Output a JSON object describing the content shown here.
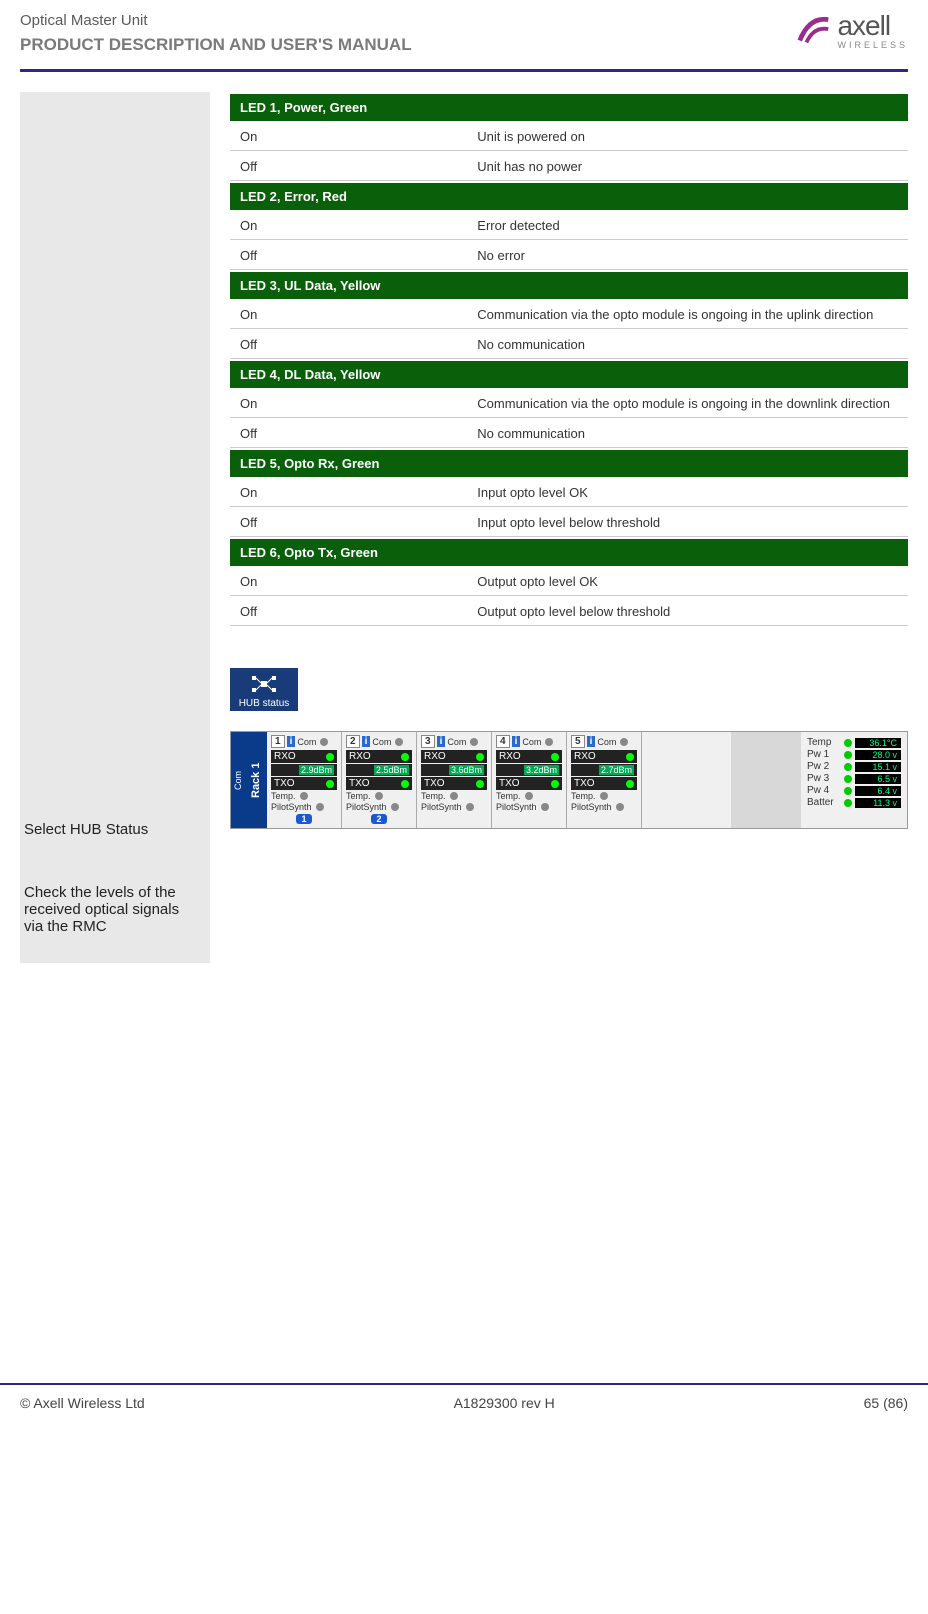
{
  "header": {
    "title": "Optical Master Unit",
    "subtitle": "PRODUCT DESCRIPTION AND USER'S MANUAL",
    "logo_main": "axell",
    "logo_sub": "WIRELESS"
  },
  "led_table": {
    "sections": [
      {
        "header": "LED 1, Power, Green",
        "rows": [
          {
            "state": "On",
            "desc": "Unit is powered on"
          },
          {
            "state": "Off",
            "desc": "Unit has no power"
          }
        ]
      },
      {
        "header": "LED 2, Error, Red",
        "rows": [
          {
            "state": "On",
            "desc": "Error detected"
          },
          {
            "state": "Off",
            "desc": "No error"
          }
        ]
      },
      {
        "header": "LED 3, UL Data, Yellow",
        "rows": [
          {
            "state": "On",
            "desc": "Communication via the opto module is ongoing in the uplink direction"
          },
          {
            "state": "Off",
            "desc": "No communication"
          }
        ]
      },
      {
        "header": "LED 4, DL Data, Yellow",
        "rows": [
          {
            "state": "On",
            "desc": "Communication via the opto module is ongoing in the downlink direction"
          },
          {
            "state": "Off",
            "desc": "No communication"
          }
        ]
      },
      {
        "header": "LED 5, Opto Rx, Green",
        "rows": [
          {
            "state": "On",
            "desc": "Input opto level OK"
          },
          {
            "state": "Off",
            "desc": "Input opto level below threshold"
          }
        ]
      },
      {
        "header": "LED 6, Opto Tx, Green",
        "rows": [
          {
            "state": "On",
            "desc": "Output opto level OK"
          },
          {
            "state": "Off",
            "desc": "Output opto level below threshold"
          }
        ]
      }
    ]
  },
  "steps": {
    "step1": "Select HUB Status",
    "step2": "Check the levels of the received optical signals via the RMC"
  },
  "hub_status_button": "HUB status",
  "rmc": {
    "rack_label": "Rack 1",
    "com_label": "Com",
    "slots": [
      {
        "num": "1",
        "rx_label": "RXO",
        "rx_val": "2.9dBm",
        "tx_label": "TXO",
        "temp": "Temp.",
        "pilot": "PilotSynth",
        "badge": "1"
      },
      {
        "num": "2",
        "rx_label": "RXO",
        "rx_val": "2.5dBm",
        "tx_label": "TXO",
        "temp": "Temp.",
        "pilot": "PilotSynth",
        "badge": "2"
      },
      {
        "num": "3",
        "rx_label": "RXO",
        "rx_val": "3.6dBm",
        "tx_label": "TXO",
        "temp": "Temp.",
        "pilot": "PilotSynth",
        "badge": ""
      },
      {
        "num": "4",
        "rx_label": "RXO",
        "rx_val": "3.2dBm",
        "tx_label": "TXO",
        "temp": "Temp.",
        "pilot": "PilotSynth",
        "badge": ""
      },
      {
        "num": "5",
        "rx_label": "RXO",
        "rx_val": "2.7dBm",
        "tx_label": "TXO",
        "temp": "Temp.",
        "pilot": "PilotSynth",
        "badge": ""
      }
    ],
    "status": [
      {
        "label": "Temp",
        "value": "36.1°C"
      },
      {
        "label": "Pw 1",
        "value": "28.0 v"
      },
      {
        "label": "Pw 2",
        "value": "15.1 v"
      },
      {
        "label": "Pw 3",
        "value": "6.5 v"
      },
      {
        "label": "Pw 4",
        "value": "6.4 v"
      },
      {
        "label": "Batter",
        "value": "11.3 v"
      }
    ]
  },
  "footer": {
    "left": "© Axell Wireless Ltd",
    "center": "A1829300 rev H",
    "right": "65 (86)"
  }
}
